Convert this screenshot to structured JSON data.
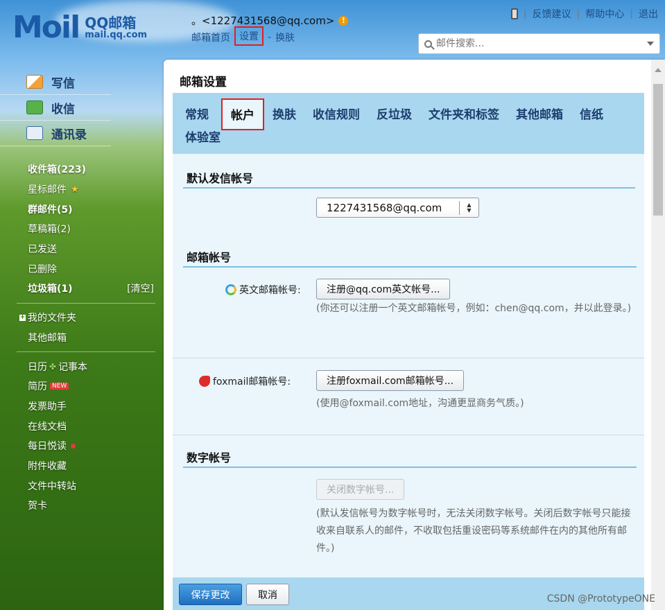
{
  "header": {
    "logo_text": "Moil",
    "brand_cn": "QQ邮箱",
    "brand_en": "mail.qq.com",
    "account": "。<1227431568@qq.com>",
    "nav": [
      "邮箱首页",
      "设置",
      "换肤"
    ],
    "nav_sep": "-",
    "top_links": [
      "反馈建议",
      "帮助中心",
      "退出"
    ],
    "search_placeholder": "邮件搜索..."
  },
  "sidebar": {
    "primary": [
      "写信",
      "收信",
      "通讯录"
    ],
    "inbox": "收件箱(223)",
    "starred": "星标邮件",
    "group": "群邮件(5)",
    "drafts": "草稿箱(2)",
    "sent": "已发送",
    "deleted": "已删除",
    "junk": "垃圾箱(1)",
    "junk_clear": "[清空]",
    "my_folders": "我的文件夹",
    "other_mailbox": "其他邮箱",
    "calendar": "日历",
    "notes": "记事本",
    "resume": "简历",
    "new_badge": "NEW",
    "tools": [
      "发票助手",
      "在线文档",
      "每日悦读",
      "附件收藏",
      "文件中转站",
      "贺卡"
    ]
  },
  "main": {
    "title": "邮箱设置",
    "tabs": [
      "常规",
      "帐户",
      "换肤",
      "收信规则",
      "反垃圾",
      "文件夹和标签",
      "其他邮箱",
      "信纸",
      "体验室"
    ],
    "active_tab": "帐户",
    "sections": {
      "default_sender": {
        "title": "默认发信帐号",
        "selected": "1227431568@qq.com"
      },
      "mail_accounts": {
        "title": "邮箱帐号",
        "english_label": "英文邮箱帐号:",
        "english_button": "注册@qq.com英文帐号...",
        "english_note": "(你还可以注册一个英文邮箱帐号，例如：chen@qq.com，并以此登录。)",
        "foxmail_label": "foxmail邮箱帐号:",
        "foxmail_button": "注册foxmail.com邮箱帐号...",
        "foxmail_note": "(使用@foxmail.com地址，沟通更显商务气质。)"
      },
      "digital_account": {
        "title": "数字帐号",
        "button": "关闭数字帐号...",
        "note": "(默认发信帐号为数字帐号时，无法关闭数字帐号。关闭后数字帐号只能接收来自联系人的邮件，不收取包括重设密码等系统邮件在内的其他所有邮件。)"
      }
    },
    "save_label": "保存更改",
    "cancel_label": "取消"
  },
  "watermark": "CSDN @PrototypeONE",
  "colors": {
    "highlight_border": "#e02020",
    "tab_bar": "#a8d7ef",
    "content_bg": "#eaf6fc",
    "save_button": "#1f6fc0"
  }
}
